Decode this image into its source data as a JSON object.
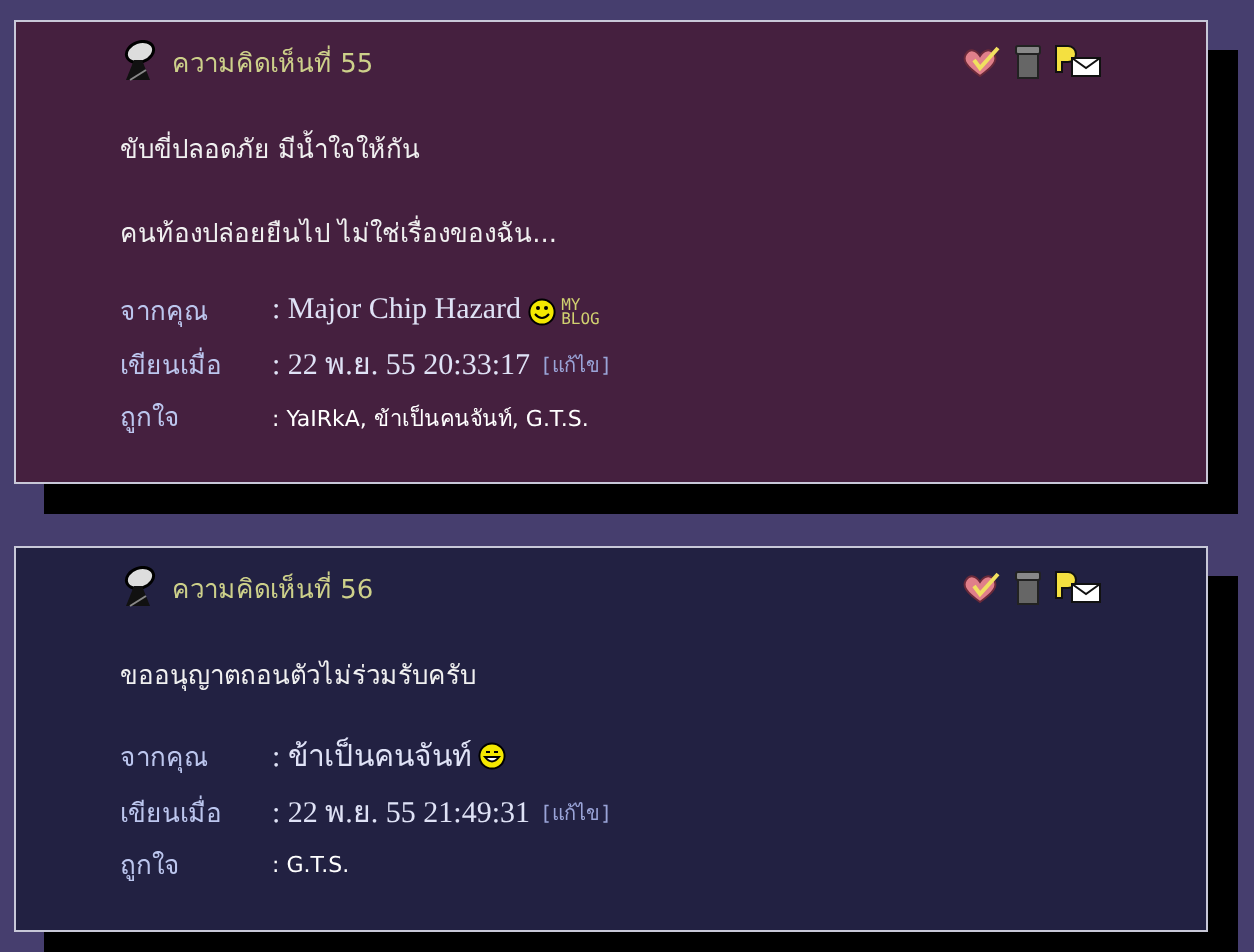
{
  "comments": [
    {
      "title": "ความคิดเห็นที่ 55",
      "color": "#45203f",
      "paragraphs": [
        "ขับขี่ปลอดภัย มีน้ำใจให้กัน",
        "คนท้องปล่อยยืนไป ไม่ใช่เรื่องของฉัน..."
      ],
      "from_label": "จากคุณ",
      "author": ": Major Chip Hazard",
      "smiley": {
        "kind": "grin"
      },
      "blog_badge": [
        "MY",
        "BLOG"
      ],
      "written_label": "เขียนเมื่อ",
      "written": ": 22 พ.ย. 55 20:33:17",
      "edit_link": "[แก้ไข]",
      "likes_label": "ถูกใจ",
      "likes": ": YaIRkA, ข้าเป็นคนจันท์, G.T.S."
    },
    {
      "title": "ความคิดเห็นที่ 56",
      "color": "#222142",
      "paragraphs": [
        "ขออนุญาตถอนตัวไม่ร่วมรับครับ"
      ],
      "from_label": "จากคุณ",
      "author": ": ข้าเป็นคนจันท์",
      "smiley": {
        "kind": "laugh"
      },
      "written_label": "เขียนเมื่อ",
      "written": ": 22 พ.ย. 55 21:49:31",
      "edit_link": "[แก้ไข]",
      "likes_label": "ถูกใจ",
      "likes": ": G.T.S."
    }
  ]
}
